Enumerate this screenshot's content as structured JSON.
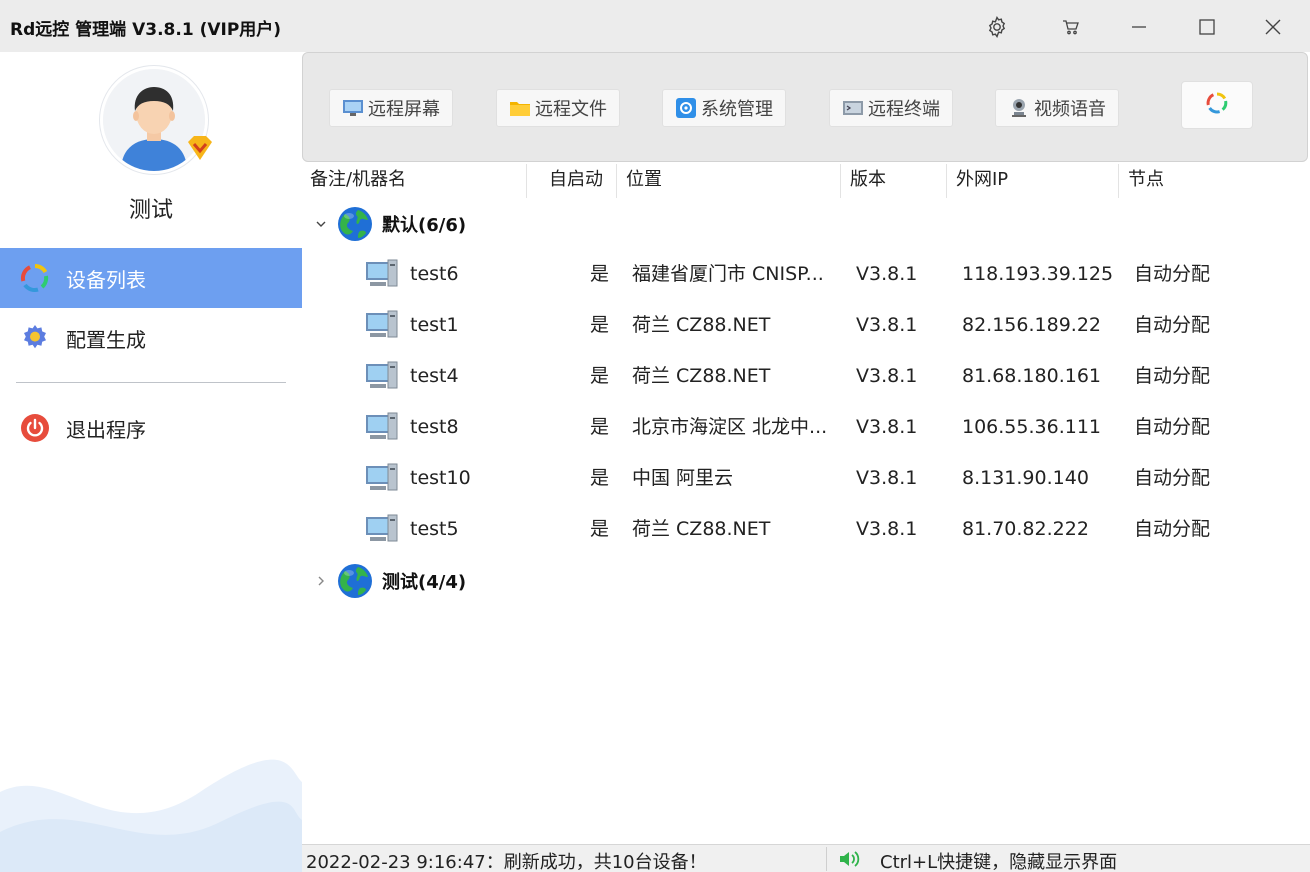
{
  "window": {
    "title": "Rd远控  管理端 V3.8.1 (VIP用户)",
    "icons": [
      "gear-icon",
      "cart-icon",
      "minimize-icon",
      "maximize-icon",
      "close-icon"
    ]
  },
  "sidebar": {
    "username": "测试",
    "items": [
      {
        "label": "设备列表",
        "icon": "device-list-icon",
        "active": true
      },
      {
        "label": "配置生成",
        "icon": "config-gear-icon",
        "active": false
      },
      {
        "label": "退出程序",
        "icon": "power-icon",
        "active": false
      }
    ],
    "accent": "#6d9ff0"
  },
  "toolbar": {
    "buttons": [
      {
        "label": "远程屏幕",
        "icon": "monitor-icon"
      },
      {
        "label": "远程文件",
        "icon": "folder-icon"
      },
      {
        "label": "系统管理",
        "icon": "system-icon"
      },
      {
        "label": "远程终端",
        "icon": "terminal-icon"
      },
      {
        "label": "视频语音",
        "icon": "webcam-icon"
      }
    ],
    "refresh_icon": "refresh-icon"
  },
  "table": {
    "columns": [
      "备注/机器名",
      "自启动",
      "位置",
      "版本",
      "外网IP",
      "节点"
    ],
    "groups": [
      {
        "label": "默认(6/6)",
        "expanded": true,
        "rows": [
          {
            "name": "test6",
            "autostart": "是",
            "location": "福建省厦门市 CNISP...",
            "version": "V3.8.1",
            "ip": "118.193.39.125",
            "node": "自动分配"
          },
          {
            "name": "test1",
            "autostart": "是",
            "location": "荷兰  CZ88.NET",
            "version": "V3.8.1",
            "ip": "82.156.189.22",
            "node": "自动分配"
          },
          {
            "name": "test4",
            "autostart": "是",
            "location": "荷兰  CZ88.NET",
            "version": "V3.8.1",
            "ip": "81.68.180.161",
            "node": "自动分配"
          },
          {
            "name": "test8",
            "autostart": "是",
            "location": "北京市海淀区 北龙中...",
            "version": "V3.8.1",
            "ip": "106.55.36.111",
            "node": "自动分配"
          },
          {
            "name": "test10",
            "autostart": "是",
            "location": "中国 阿里云",
            "version": "V3.8.1",
            "ip": "8.131.90.140",
            "node": "自动分配"
          },
          {
            "name": "test5",
            "autostart": "是",
            "location": "荷兰  CZ88.NET",
            "version": "V3.8.1",
            "ip": "81.70.82.222",
            "node": "自动分配"
          }
        ]
      },
      {
        "label": "测试(4/4)",
        "expanded": false,
        "rows": []
      }
    ]
  },
  "status": {
    "left": "2022-02-23 9:16:47：刷新成功，共10台设备！",
    "right": "Ctrl+L快捷键，隐藏显示界面",
    "right_icon": "speaker-icon"
  }
}
